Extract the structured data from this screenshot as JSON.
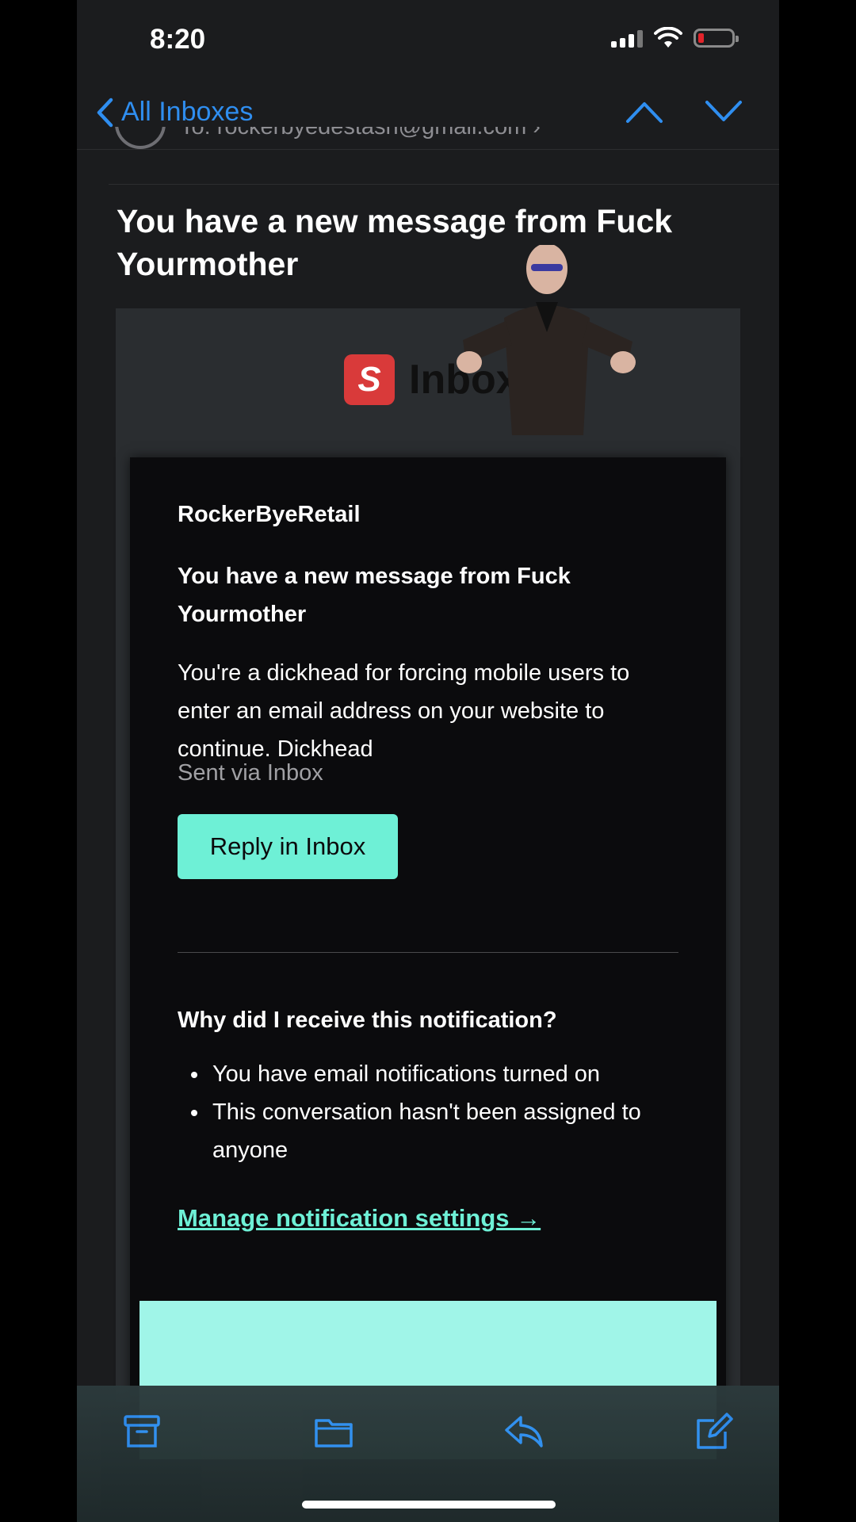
{
  "status_bar": {
    "time": "8:20"
  },
  "nav": {
    "back_label": "All Inboxes"
  },
  "header": {
    "to_prefix": "To:",
    "to_address": "rockerbyedestash@gmail.com",
    "subject": "You have a new message from Fuck Yourmother"
  },
  "email": {
    "logo_letter": "S",
    "logo_text": "Inbox",
    "sender_name": "RockerByeRetail",
    "subject": "You have a new message from Fuck Yourmother",
    "body": "You're a dickhead for forcing mobile users to enter an email address on your website to continue. Dickhead",
    "sent_via": "Sent via Inbox",
    "reply_button": "Reply in Inbox",
    "why_heading": "Why did I receive this notification?",
    "reasons": [
      "You have email notifications turned on",
      "This conversation hasn't been assigned to anyone"
    ],
    "manage_link": "Manage notification settings →"
  },
  "toolbar": {
    "icons": [
      "archive-icon",
      "folder-icon",
      "reply-icon",
      "compose-icon"
    ]
  },
  "colors": {
    "accent_blue": "#2f8ef0",
    "teal": "#6ef0d6",
    "battery_low": "#e2242b"
  }
}
